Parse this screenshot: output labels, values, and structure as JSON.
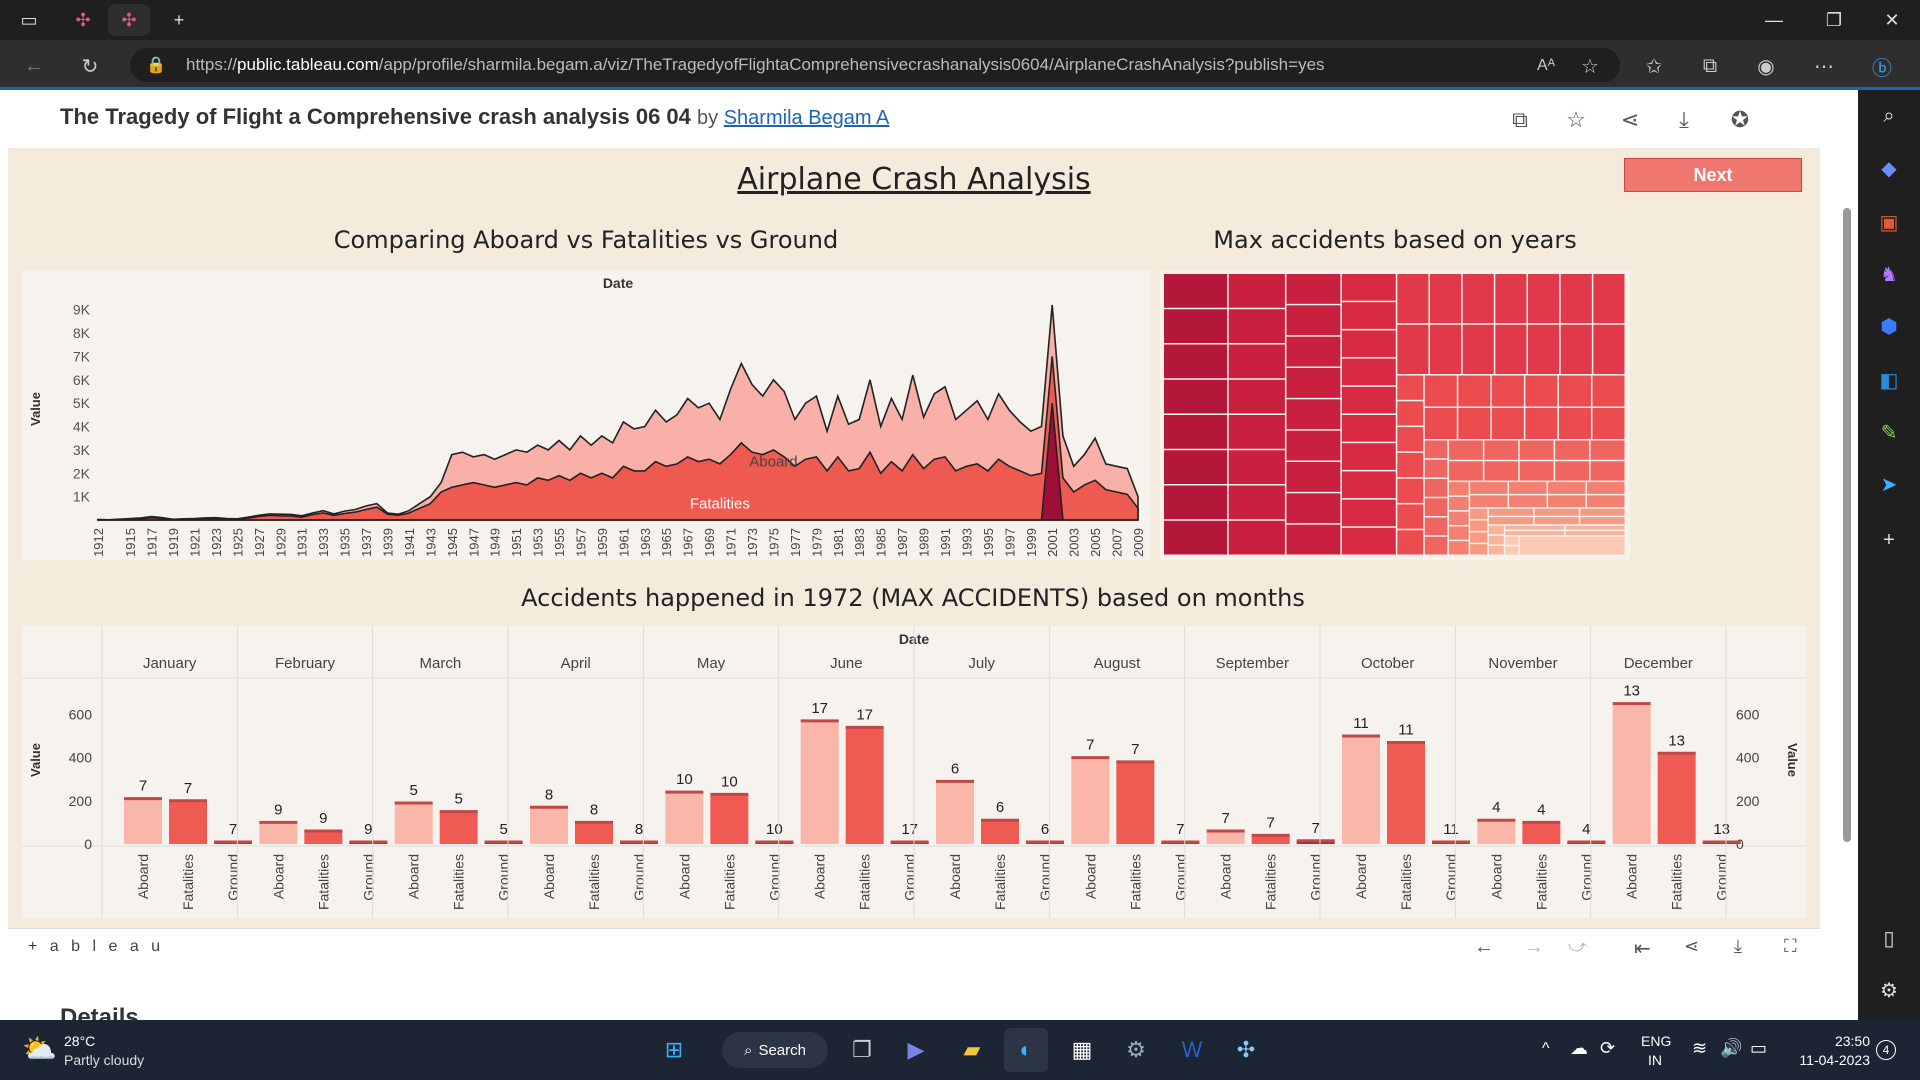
{
  "browser": {
    "url_prefix": "https://",
    "url_host": "public.tableau.com",
    "url_path": "/app/profile/sharmila.begam.a/viz/TheTragedyofFlightaComprehensivecrashanalysis0604/AirplaneCrashAnalysis?publish=yes"
  },
  "viz_header": {
    "title": "The Tragedy of Flight a Comprehensive crash analysis 06 04",
    "by": "by",
    "author": "Sharmila Begam A"
  },
  "dashboard": {
    "title": "Airplane Crash Analysis",
    "next_button": "Next",
    "area_title": "Comparing Aboard vs Fatalities vs Ground",
    "treemap_title": "Max accidents based on years",
    "bar_title": "Accidents happened in 1972 (MAX ACCIDENTS) based on months"
  },
  "footer": {
    "logo": "+ a b l e a u",
    "details_peek": "Details"
  },
  "taskbar": {
    "temp": "28°C",
    "weather": "Partly cloudy",
    "search": "Search",
    "lang1": "ENG",
    "lang2": "IN",
    "time": "23:50",
    "date": "11-04-2023",
    "badge": "4"
  },
  "chart_data": [
    {
      "type": "area",
      "title": "Comparing Aboard vs Fatalities vs Ground",
      "xlabel": "Date",
      "ylabel": "Value",
      "ylim": [
        0,
        9500
      ],
      "yticks": [
        "1K",
        "2K",
        "3K",
        "4K",
        "5K",
        "6K",
        "7K",
        "8K",
        "9K"
      ],
      "x": [
        1912,
        1913,
        1915,
        1916,
        1917,
        1918,
        1919,
        1920,
        1921,
        1922,
        1923,
        1924,
        1925,
        1926,
        1927,
        1928,
        1929,
        1930,
        1931,
        1932,
        1933,
        1934,
        1935,
        1936,
        1937,
        1938,
        1939,
        1940,
        1941,
        1942,
        1943,
        1944,
        1945,
        1946,
        1947,
        1948,
        1949,
        1950,
        1951,
        1952,
        1953,
        1954,
        1955,
        1956,
        1957,
        1958,
        1959,
        1960,
        1961,
        1962,
        1963,
        1964,
        1965,
        1966,
        1967,
        1968,
        1969,
        1970,
        1971,
        1972,
        1973,
        1974,
        1975,
        1976,
        1977,
        1978,
        1979,
        1980,
        1981,
        1982,
        1983,
        1984,
        1985,
        1986,
        1987,
        1988,
        1989,
        1990,
        1991,
        1992,
        1993,
        1994,
        1995,
        1996,
        1997,
        1998,
        1999,
        2000,
        2001,
        2002,
        2003,
        2004,
        2005,
        2006,
        2007,
        2008,
        2009
      ],
      "series": [
        {
          "name": "Aboard",
          "values": [
            20,
            10,
            60,
            90,
            150,
            100,
            30,
            50,
            60,
            90,
            100,
            60,
            50,
            120,
            200,
            260,
            250,
            240,
            180,
            300,
            400,
            260,
            380,
            450,
            600,
            700,
            300,
            250,
            400,
            700,
            1000,
            1600,
            2800,
            2900,
            2700,
            2800,
            2600,
            2800,
            3000,
            2900,
            3200,
            3000,
            3400,
            3000,
            3600,
            3200,
            3600,
            3300,
            4200,
            3900,
            4000,
            4700,
            4200,
            4500,
            5200,
            4800,
            5000,
            4300,
            5600,
            6700,
            5800,
            5300,
            6000,
            5500,
            4300,
            5000,
            5300,
            3800,
            5300,
            4100,
            4300,
            6000,
            4000,
            5200,
            4300,
            6200,
            4400,
            5400,
            5700,
            4300,
            4700,
            5100,
            4300,
            5400,
            4700,
            4200,
            3800,
            4000,
            9200,
            3600,
            2300,
            2800,
            3500,
            2400,
            2300,
            2200,
            1000
          ]
        },
        {
          "name": "Fatalities",
          "values": [
            10,
            5,
            40,
            60,
            100,
            70,
            20,
            30,
            40,
            60,
            70,
            40,
            30,
            80,
            150,
            200,
            180,
            170,
            120,
            230,
            300,
            200,
            280,
            340,
            450,
            550,
            250,
            200,
            300,
            500,
            700,
            1200,
            1400,
            1500,
            1600,
            1500,
            1400,
            1500,
            1600,
            1500,
            1800,
            1700,
            1900,
            1700,
            2000,
            1800,
            2000,
            1800,
            2300,
            2100,
            2100,
            2500,
            2300,
            2400,
            2700,
            2500,
            2600,
            2400,
            2800,
            3300,
            2900,
            2800,
            3000,
            2700,
            2300,
            2600,
            2700,
            2100,
            2700,
            2100,
            2200,
            2900,
            2000,
            2500,
            2100,
            2800,
            2200,
            2600,
            2700,
            2100,
            2300,
            2400,
            2100,
            2600,
            2300,
            2100,
            1900,
            2000,
            7000,
            1800,
            1200,
            1500,
            1700,
            1300,
            1200,
            1100,
            500
          ]
        },
        {
          "name": "Ground",
          "values": [
            0,
            0,
            0,
            0,
            0,
            0,
            0,
            0,
            0,
            0,
            0,
            0,
            0,
            0,
            0,
            0,
            0,
            0,
            0,
            0,
            0,
            0,
            0,
            0,
            0,
            0,
            0,
            0,
            0,
            0,
            0,
            0,
            0,
            0,
            0,
            0,
            0,
            0,
            0,
            0,
            0,
            0,
            0,
            0,
            0,
            0,
            0,
            0,
            0,
            0,
            0,
            0,
            0,
            0,
            0,
            0,
            0,
            0,
            0,
            0,
            0,
            0,
            0,
            0,
            0,
            0,
            0,
            0,
            0,
            0,
            0,
            0,
            0,
            0,
            0,
            0,
            0,
            0,
            0,
            0,
            0,
            0,
            0,
            0,
            0,
            0,
            0,
            0,
            5000,
            0,
            0,
            0,
            0,
            0,
            0,
            0,
            0
          ]
        }
      ],
      "xticks": [
        "1912",
        "1915",
        "1917",
        "1919",
        "1921",
        "1923",
        "1925",
        "1927",
        "1929",
        "1931",
        "1933",
        "1935",
        "1937",
        "1939",
        "1941",
        "1943",
        "1945",
        "1947",
        "1949",
        "1951",
        "1953",
        "1955",
        "1957",
        "1959",
        "1961",
        "1963",
        "1965",
        "1967",
        "1969",
        "1971",
        "1973",
        "1975",
        "1977",
        "1979",
        "1981",
        "1983",
        "1985",
        "1987",
        "1989",
        "1991",
        "1993",
        "1995",
        "1997",
        "1999",
        "2001",
        "2003",
        "2005",
        "2007",
        "2009"
      ],
      "colors": {
        "Aboard": "#f8b0a8",
        "Fatalities": "#ee5a50",
        "Ground": "#9b0f38"
      }
    },
    {
      "type": "heatmap",
      "subtype": "treemap",
      "title": "Max accidents based on years",
      "colors": [
        "#b5173a",
        "#c8203e",
        "#d82a42",
        "#e2394a",
        "#ea4c50",
        "#ef6660",
        "#f38070",
        "#f79a84",
        "#f9b39c",
        "#fbc9b4"
      ]
    },
    {
      "type": "bar",
      "title": "Accidents happened in 1972 (MAX ACCIDENTS) based on months",
      "xlabel": "Date",
      "ylabel": "Value",
      "ylim": [
        0,
        750
      ],
      "yticks": [
        "0",
        "200",
        "400",
        "600"
      ],
      "months": [
        "January",
        "February",
        "March",
        "April",
        "May",
        "June",
        "July",
        "August",
        "September",
        "October",
        "November",
        "December"
      ],
      "categories": [
        "Aboard",
        "Fatalities",
        "Ground"
      ],
      "series": [
        {
          "name": "Aboard",
          "values": [
            210,
            100,
            190,
            170,
            240,
            570,
            290,
            400,
            60,
            500,
            110,
            650
          ]
        },
        {
          "name": "Fatalities",
          "values": [
            200,
            60,
            150,
            100,
            230,
            540,
            110,
            380,
            40,
            470,
            100,
            420
          ]
        },
        {
          "name": "Ground",
          "values": [
            0,
            0,
            0,
            0,
            0,
            0,
            0,
            0,
            15,
            0,
            0,
            0
          ]
        }
      ],
      "labels": [
        [
          7,
          7,
          7
        ],
        [
          9,
          9,
          9
        ],
        [
          5,
          5,
          5
        ],
        [
          8,
          8,
          8
        ],
        [
          10,
          10,
          10
        ],
        [
          17,
          17,
          17
        ],
        [
          6,
          6,
          6
        ],
        [
          7,
          7,
          7
        ],
        [
          7,
          7,
          7
        ],
        [
          11,
          11,
          11
        ],
        [
          4,
          4,
          4
        ],
        [
          13,
          13,
          13
        ]
      ],
      "colors": {
        "Aboard": "#fbb6aa",
        "Fatalities": "#ef5b52",
        "Ground": "#b0253e"
      }
    }
  ]
}
